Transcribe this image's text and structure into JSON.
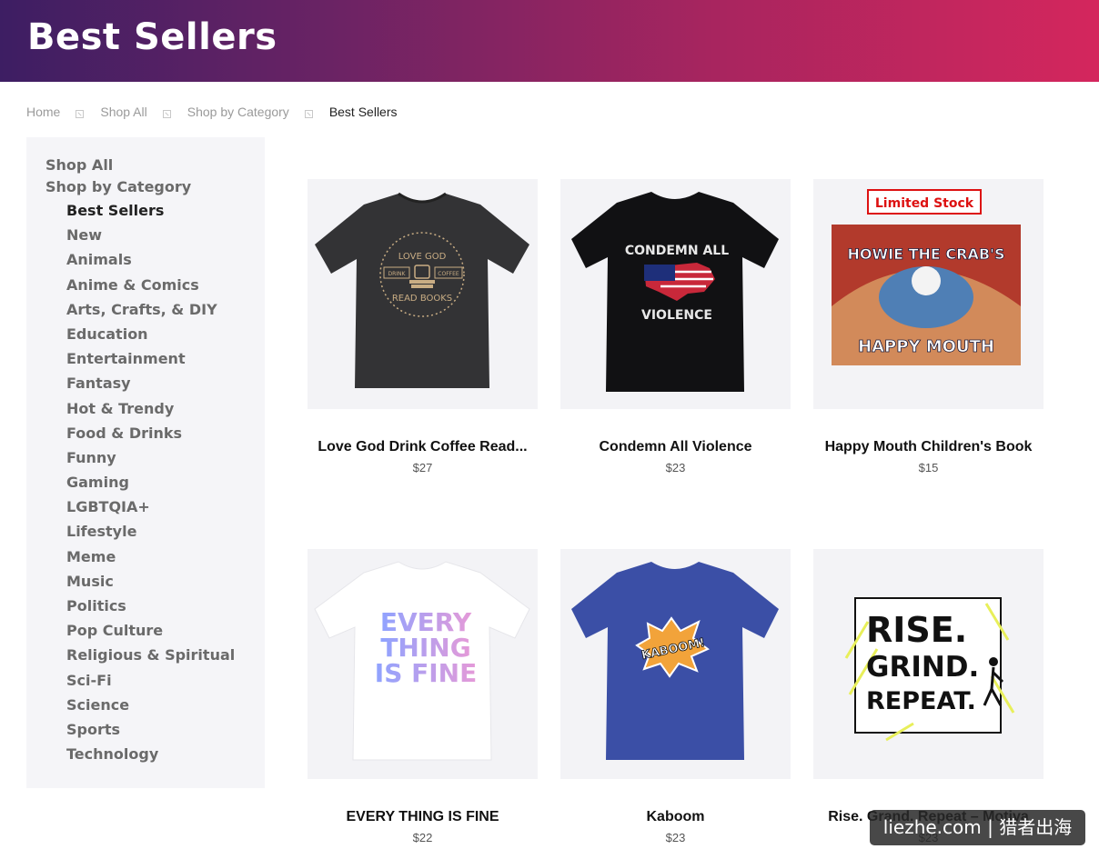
{
  "header": {
    "title": "Best Sellers"
  },
  "breadcrumb": [
    "Home",
    "Shop All",
    "Shop by Category",
    "Best Sellers"
  ],
  "sidebar": {
    "shop_all": "Shop All",
    "shop_by_category": "Shop by Category",
    "items": [
      "Best Sellers",
      "New",
      "Animals",
      "Anime & Comics",
      "Arts, Crafts, & DIY",
      "Education",
      "Entertainment",
      "Fantasy",
      "Hot & Trendy",
      "Food & Drinks",
      "Funny",
      "Gaming",
      "LGBTQIA+",
      "Lifestyle",
      "Meme",
      "Music",
      "Politics",
      "Pop Culture",
      "Religious & Spiritual",
      "Sci-Fi",
      "Science",
      "Sports",
      "Technology"
    ]
  },
  "products": [
    {
      "name": "Love God Drink Coffee Read...",
      "price": "$27",
      "art": {
        "line1": "LOVE GOD",
        "left": "DRINK",
        "right": "COFFEE",
        "line2": "READ BOOKS"
      }
    },
    {
      "name": "Condemn All Violence",
      "price": "$23",
      "art": {
        "line1": "CONDEMN ALL",
        "line2": "VIOLENCE"
      }
    },
    {
      "name": "Happy Mouth Children's Book",
      "price": "$15",
      "art": {
        "badge": "Limited Stock",
        "line1": "HOWIE THE CRAB'S",
        "line2": "HAPPY MOUTH"
      }
    },
    {
      "name": "EVERY THING IS FINE",
      "price": "$22",
      "art": {
        "line1": "EVERY",
        "line2": "THING",
        "line3": "IS FINE"
      }
    },
    {
      "name": "Kaboom",
      "price": "$23",
      "art": {
        "line1": "KABOOM!"
      }
    },
    {
      "name": "Rise. Grand. Repeat – Motiva",
      "price": "$23",
      "art": {
        "line1": "RISE.",
        "line2": "GRIND.",
        "line3": "REPEAT."
      }
    }
  ],
  "watermark": "liezhe.com | 猎者出海",
  "colors": {
    "header_start": "#3d1e63",
    "header_end": "#d4265d",
    "sidebar_bg": "#f5f5f8"
  }
}
